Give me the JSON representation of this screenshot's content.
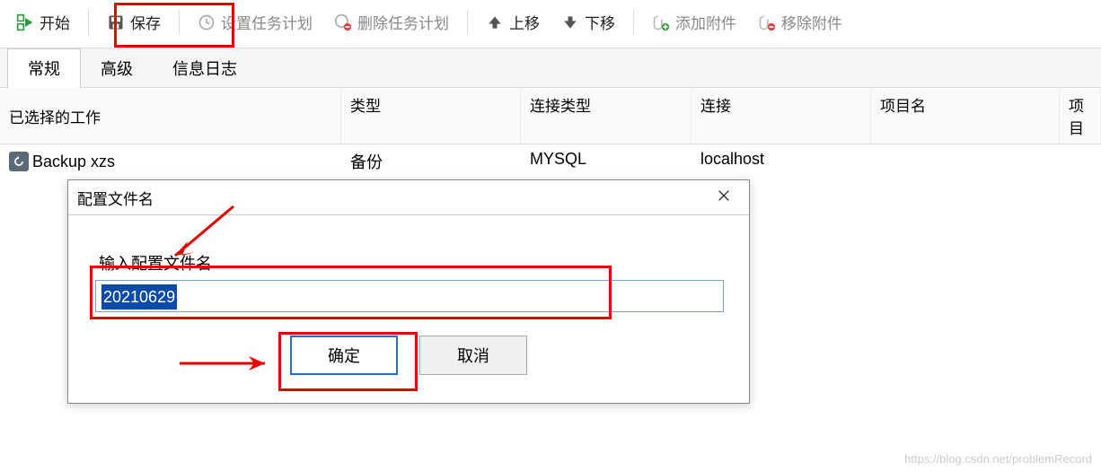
{
  "toolbar": {
    "start": "开始",
    "save": "保存",
    "setTaskPlan": "设置任务计划",
    "deleteTaskPlan": "删除任务计划",
    "moveUp": "上移",
    "moveDown": "下移",
    "addAttachment": "添加附件",
    "removeAttachment": "移除附件"
  },
  "tabs": {
    "general": "常规",
    "advanced": "高级",
    "log": "信息日志"
  },
  "columns": {
    "job": "已选择的工作",
    "type": "类型",
    "connType": "连接类型",
    "conn": "连接",
    "project": "项目名",
    "projectShort": "项目"
  },
  "row": {
    "job": "Backup xzs",
    "type": "备份",
    "connType": "MYSQL",
    "conn": "localhost",
    "project": ""
  },
  "dialog": {
    "title": "配置文件名",
    "label": "输入配置文件名",
    "value": "20210629",
    "ok": "确定",
    "cancel": "取消"
  },
  "watermark": "https://blog.csdn.net/problemRecord"
}
